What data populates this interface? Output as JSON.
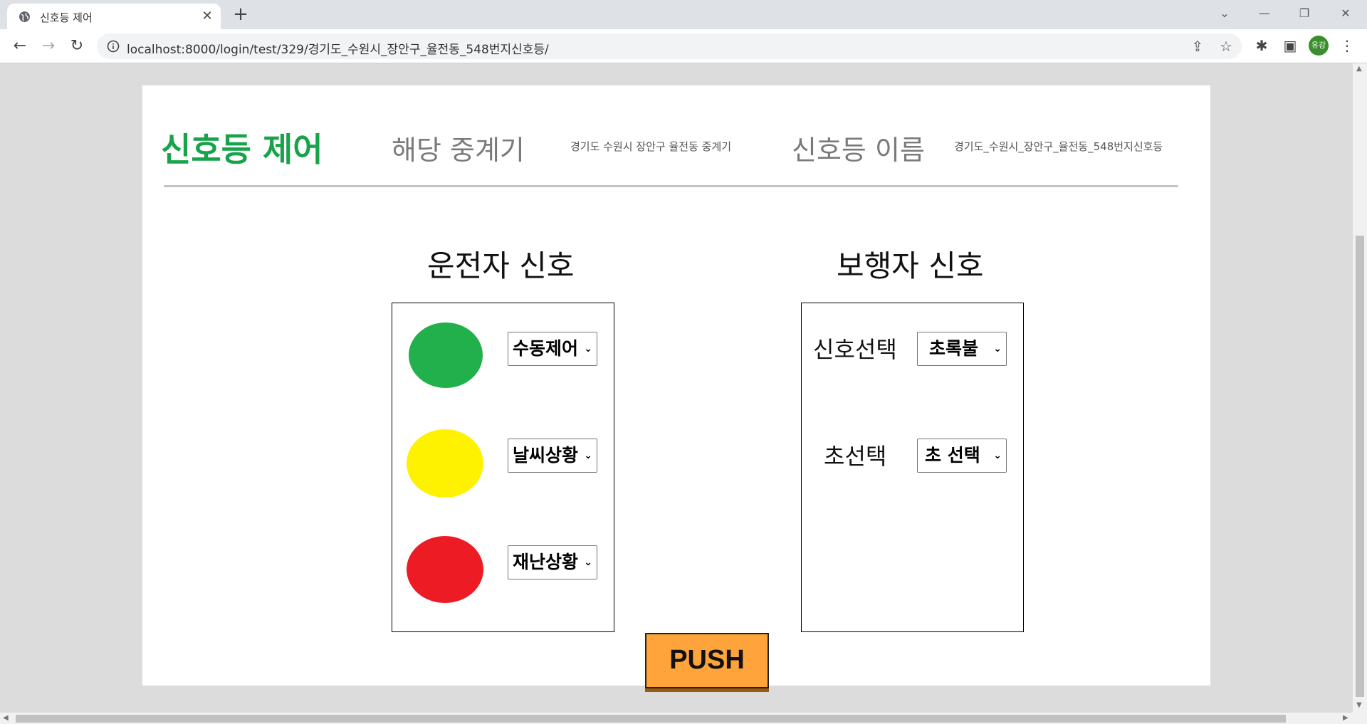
{
  "browser": {
    "tab_title": "신호등 제어",
    "url": "localhost:8000/login/test/329/경기도_수원시_장안구_율전동_548번지신호등/",
    "profile_initials": "유강"
  },
  "header": {
    "brand": "신호등 제어",
    "repeater_label": "해당 중계기",
    "repeater_value": "경기도 수원시 장안구 율전동 중계기",
    "light_name_label": "신호등 이름",
    "light_name_value": "경기도_수원시_장안구_율전동_548번지신호등"
  },
  "driver": {
    "title": "운전자 신호",
    "lights": [
      {
        "color": "#21b04b",
        "select": "수동제어"
      },
      {
        "color": "#fff200",
        "select": "날씨상황"
      },
      {
        "color": "#ed1c24",
        "select": "재난상황"
      }
    ]
  },
  "pedestrian": {
    "title": "보행자 신호",
    "signal_label": "신호선택",
    "signal_select": "초록불",
    "seconds_label": "초선택",
    "seconds_select": "초 선택"
  },
  "push_label": "PUSH",
  "colors": {
    "brand": "#17a34a",
    "push": "#ffa43a"
  }
}
